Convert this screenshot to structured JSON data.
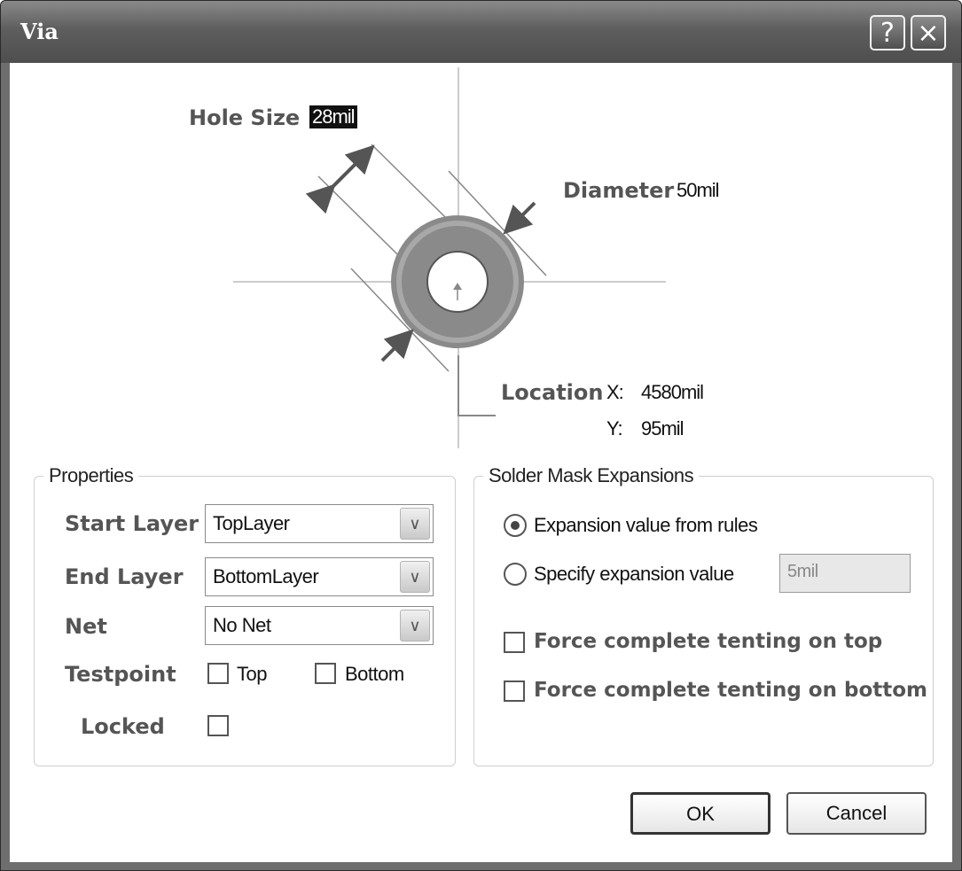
{
  "window": {
    "title": "Via",
    "help_icon": "?",
    "close_icon": "×"
  },
  "diagram": {
    "hole_size_label": "Hole Size",
    "hole_size_value": "28mil",
    "diameter_label": "Diameter",
    "diameter_value": "50mil",
    "location_label": "Location",
    "x_label": "X:",
    "x_value": "4580mil",
    "y_label": "Y:",
    "y_value": "95mil"
  },
  "properties": {
    "title": "Properties",
    "start_layer_label": "Start Layer",
    "start_layer_value": "TopLayer",
    "end_layer_label": "End Layer",
    "end_layer_value": "BottomLayer",
    "net_label": "Net",
    "net_value": "No Net",
    "testpoint_label": "Testpoint",
    "testpoint_top": "Top",
    "testpoint_bottom": "Bottom",
    "locked_label": "Locked"
  },
  "solder_mask": {
    "title": "Solder Mask Expansions",
    "option_rules": "Expansion value from rules",
    "option_specify": "Specify expansion value",
    "specify_value": "5mil",
    "force_top": "Force complete tenting on top",
    "force_bottom": "Force complete tenting on bottom"
  },
  "buttons": {
    "ok": "OK",
    "cancel": "Cancel"
  }
}
